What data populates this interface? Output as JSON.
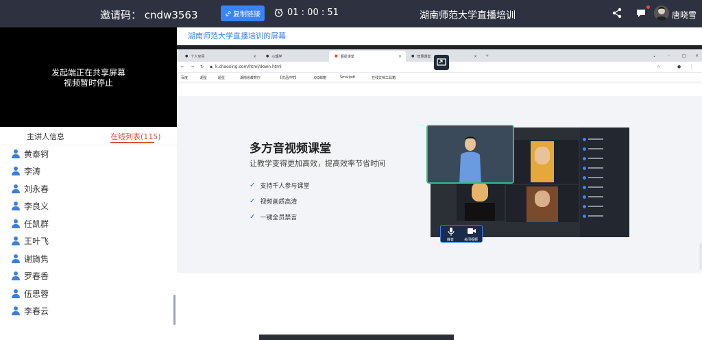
{
  "topbar": {
    "invite_label": "邀请码：",
    "invite_code": "cndw3563",
    "copy_button": "复制链接",
    "timer": "01 : 00 : 51",
    "room_title": "湖南师范大学直播培训",
    "user_name": "唐晓雪"
  },
  "video": {
    "line1": "发起端正在共享屏幕",
    "line2": "视频暂时停止"
  },
  "tabs": {
    "host_info": "主讲人信息",
    "online_list": "在线列表",
    "online_count": "(115)"
  },
  "members": [
    "黄泰钶",
    "李涛",
    "刘永春",
    "李良义",
    "任凯群",
    "王叶飞",
    "谢旖隽",
    "罗春香",
    "伍思蓉",
    "李春云"
  ],
  "share": {
    "label": "湖南师范大学直播培训的屏幕"
  },
  "browser": {
    "tabs": [
      "个人空间",
      "心理学",
      "超星课堂",
      "智慧课堂"
    ],
    "url": "k.chaoxing.com/html/down.html",
    "bookmarks": [
      "百度",
      "超星",
      "超星",
      "湖南省教育厅",
      "【优品PPT】",
      "QQ邮箱",
      "Smallpdf",
      "在线文档工具箱"
    ]
  },
  "hero": {
    "title": "多方音视频课堂",
    "subtitle": "让教学变得更加高效，提高效率节省时间",
    "features": [
      "支持千人参与课堂",
      "视频画质高清",
      "一键全员禁言"
    ]
  },
  "conference_controls": [
    "静音",
    "关闭视频"
  ],
  "colors": {
    "topbar": "#2e3240",
    "accent_blue": "#3b82f6",
    "accent_red": "#e0503a",
    "member_icon": "#3d7fd8"
  }
}
